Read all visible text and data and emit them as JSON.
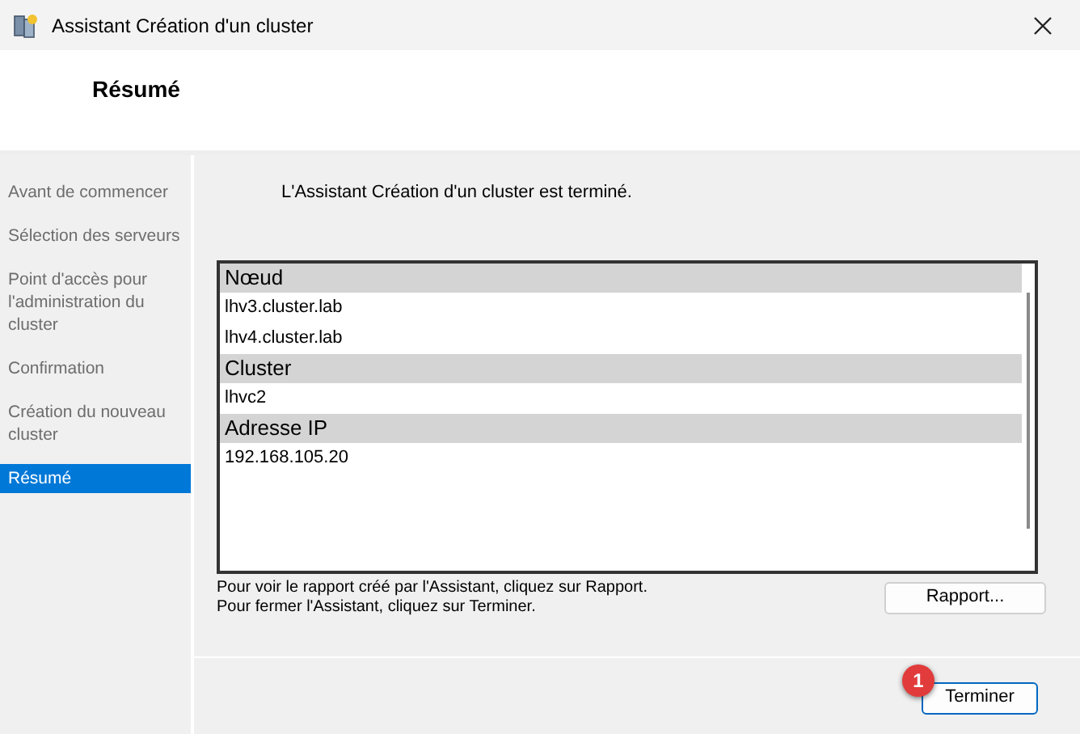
{
  "window": {
    "title": "Assistant Création d'un cluster"
  },
  "header": {
    "title": "Résumé"
  },
  "steps": [
    {
      "label": "Avant de commencer",
      "selected": false
    },
    {
      "label": "Sélection des serveurs",
      "selected": false
    },
    {
      "label": "Point d'accès pour l'administration du cluster",
      "selected": false
    },
    {
      "label": "Confirmation",
      "selected": false
    },
    {
      "label": "Création du nouveau cluster",
      "selected": false
    },
    {
      "label": "Résumé",
      "selected": true
    }
  ],
  "message": "L'Assistant Création d'un cluster est terminé.",
  "report": {
    "groups": [
      {
        "heading": "Nœud",
        "items": [
          "lhv3.cluster.lab",
          "lhv4.cluster.lab"
        ]
      },
      {
        "heading": "Cluster",
        "items": [
          "lhvc2"
        ]
      },
      {
        "heading": "Adresse IP",
        "items": [
          "192.168.105.20"
        ]
      }
    ]
  },
  "hints": [
    "Pour voir le rapport créé par l'Assistant, cliquez sur Rapport.",
    "Pour fermer l'Assistant, cliquez sur Terminer."
  ],
  "buttons": {
    "report": "Rapport...",
    "finish": "Terminer"
  },
  "badge": "1"
}
